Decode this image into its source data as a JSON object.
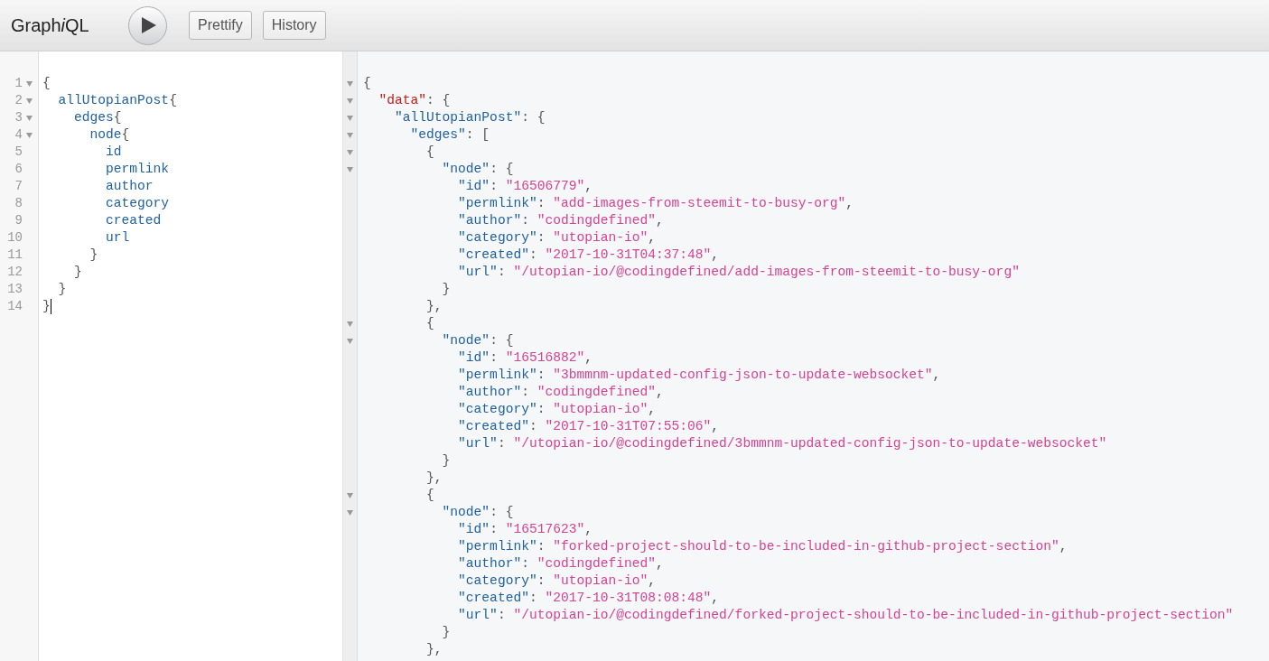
{
  "toolbar": {
    "title": [
      {
        "text": "Graph",
        "italic": false
      },
      {
        "text": "i",
        "italic": true
      },
      {
        "text": "QL",
        "italic": false
      }
    ],
    "buttons": [
      "Prettify",
      "History"
    ]
  },
  "query_editor": {
    "lines": [
      {
        "number": "1",
        "foldable": true,
        "cursor": false,
        "tokens": [
          {
            "kind": "punct",
            "text": "{"
          }
        ]
      },
      {
        "number": "2",
        "foldable": true,
        "cursor": false,
        "tokens": [
          {
            "kind": "field",
            "text": "  allUtopianPost"
          },
          {
            "kind": "punct",
            "text": "{"
          }
        ]
      },
      {
        "number": "3",
        "foldable": true,
        "cursor": false,
        "tokens": [
          {
            "kind": "field",
            "text": "    edges"
          },
          {
            "kind": "punct",
            "text": "{"
          }
        ]
      },
      {
        "number": "4",
        "foldable": true,
        "cursor": false,
        "tokens": [
          {
            "kind": "field",
            "text": "      node"
          },
          {
            "kind": "punct",
            "text": "{"
          }
        ]
      },
      {
        "number": "5",
        "foldable": false,
        "cursor": false,
        "tokens": [
          {
            "kind": "field",
            "text": "        id"
          }
        ]
      },
      {
        "number": "6",
        "foldable": false,
        "cursor": false,
        "tokens": [
          {
            "kind": "field",
            "text": "        permlink"
          }
        ]
      },
      {
        "number": "7",
        "foldable": false,
        "cursor": false,
        "tokens": [
          {
            "kind": "field",
            "text": "        author"
          }
        ]
      },
      {
        "number": "8",
        "foldable": false,
        "cursor": false,
        "tokens": [
          {
            "kind": "field",
            "text": "        category"
          }
        ]
      },
      {
        "number": "9",
        "foldable": false,
        "cursor": false,
        "tokens": [
          {
            "kind": "field",
            "text": "        created"
          }
        ]
      },
      {
        "number": "10",
        "foldable": false,
        "cursor": false,
        "tokens": [
          {
            "kind": "field",
            "text": "        url"
          }
        ]
      },
      {
        "number": "11",
        "foldable": false,
        "cursor": false,
        "tokens": [
          {
            "kind": "punct",
            "text": "      }"
          }
        ]
      },
      {
        "number": "12",
        "foldable": false,
        "cursor": false,
        "tokens": [
          {
            "kind": "punct",
            "text": "    }"
          }
        ]
      },
      {
        "number": "13",
        "foldable": false,
        "cursor": false,
        "tokens": [
          {
            "kind": "punct",
            "text": "  }"
          }
        ]
      },
      {
        "number": "14",
        "foldable": false,
        "cursor": true,
        "tokens": [
          {
            "kind": "punct",
            "text": "}"
          }
        ]
      }
    ]
  },
  "result_viewer": {
    "lines": [
      {
        "foldable": true,
        "tokens": [
          {
            "kind": "punct",
            "text": "{"
          }
        ]
      },
      {
        "foldable": true,
        "tokens": [
          {
            "kind": "root_key",
            "text": "  \"data\""
          },
          {
            "kind": "punct",
            "text": ": {"
          }
        ]
      },
      {
        "foldable": true,
        "tokens": [
          {
            "kind": "key",
            "text": "    \"allUtopianPost\""
          },
          {
            "kind": "punct",
            "text": ": {"
          }
        ]
      },
      {
        "foldable": true,
        "tokens": [
          {
            "kind": "key",
            "text": "      \"edges\""
          },
          {
            "kind": "punct",
            "text": ": ["
          }
        ]
      },
      {
        "foldable": true,
        "tokens": [
          {
            "kind": "punct",
            "text": "        {"
          }
        ]
      },
      {
        "foldable": true,
        "tokens": [
          {
            "kind": "key",
            "text": "          \"node\""
          },
          {
            "kind": "punct",
            "text": ": {"
          }
        ]
      },
      {
        "foldable": false,
        "tokens": [
          {
            "kind": "key",
            "text": "            \"id\""
          },
          {
            "kind": "punct",
            "text": ": "
          },
          {
            "kind": "string",
            "text": "\"16506779\""
          },
          {
            "kind": "punct",
            "text": ","
          }
        ]
      },
      {
        "foldable": false,
        "tokens": [
          {
            "kind": "key",
            "text": "            \"permlink\""
          },
          {
            "kind": "punct",
            "text": ": "
          },
          {
            "kind": "string",
            "text": "\"add-images-from-steemit-to-busy-org\""
          },
          {
            "kind": "punct",
            "text": ","
          }
        ]
      },
      {
        "foldable": false,
        "tokens": [
          {
            "kind": "key",
            "text": "            \"author\""
          },
          {
            "kind": "punct",
            "text": ": "
          },
          {
            "kind": "string",
            "text": "\"codingdefined\""
          },
          {
            "kind": "punct",
            "text": ","
          }
        ]
      },
      {
        "foldable": false,
        "tokens": [
          {
            "kind": "key",
            "text": "            \"category\""
          },
          {
            "kind": "punct",
            "text": ": "
          },
          {
            "kind": "string",
            "text": "\"utopian-io\""
          },
          {
            "kind": "punct",
            "text": ","
          }
        ]
      },
      {
        "foldable": false,
        "tokens": [
          {
            "kind": "key",
            "text": "            \"created\""
          },
          {
            "kind": "punct",
            "text": ": "
          },
          {
            "kind": "string",
            "text": "\"2017-10-31T04:37:48\""
          },
          {
            "kind": "punct",
            "text": ","
          }
        ]
      },
      {
        "foldable": false,
        "tokens": [
          {
            "kind": "key",
            "text": "            \"url\""
          },
          {
            "kind": "punct",
            "text": ": "
          },
          {
            "kind": "string",
            "text": "\"/utopian-io/@codingdefined/add-images-from-steemit-to-busy-org\""
          }
        ]
      },
      {
        "foldable": false,
        "tokens": [
          {
            "kind": "punct",
            "text": "          }"
          }
        ]
      },
      {
        "foldable": false,
        "tokens": [
          {
            "kind": "punct",
            "text": "        },"
          }
        ]
      },
      {
        "foldable": true,
        "tokens": [
          {
            "kind": "punct",
            "text": "        {"
          }
        ]
      },
      {
        "foldable": true,
        "tokens": [
          {
            "kind": "key",
            "text": "          \"node\""
          },
          {
            "kind": "punct",
            "text": ": {"
          }
        ]
      },
      {
        "foldable": false,
        "tokens": [
          {
            "kind": "key",
            "text": "            \"id\""
          },
          {
            "kind": "punct",
            "text": ": "
          },
          {
            "kind": "string",
            "text": "\"16516882\""
          },
          {
            "kind": "punct",
            "text": ","
          }
        ]
      },
      {
        "foldable": false,
        "tokens": [
          {
            "kind": "key",
            "text": "            \"permlink\""
          },
          {
            "kind": "punct",
            "text": ": "
          },
          {
            "kind": "string",
            "text": "\"3bmmnm-updated-config-json-to-update-websocket\""
          },
          {
            "kind": "punct",
            "text": ","
          }
        ]
      },
      {
        "foldable": false,
        "tokens": [
          {
            "kind": "key",
            "text": "            \"author\""
          },
          {
            "kind": "punct",
            "text": ": "
          },
          {
            "kind": "string",
            "text": "\"codingdefined\""
          },
          {
            "kind": "punct",
            "text": ","
          }
        ]
      },
      {
        "foldable": false,
        "tokens": [
          {
            "kind": "key",
            "text": "            \"category\""
          },
          {
            "kind": "punct",
            "text": ": "
          },
          {
            "kind": "string",
            "text": "\"utopian-io\""
          },
          {
            "kind": "punct",
            "text": ","
          }
        ]
      },
      {
        "foldable": false,
        "tokens": [
          {
            "kind": "key",
            "text": "            \"created\""
          },
          {
            "kind": "punct",
            "text": ": "
          },
          {
            "kind": "string",
            "text": "\"2017-10-31T07:55:06\""
          },
          {
            "kind": "punct",
            "text": ","
          }
        ]
      },
      {
        "foldable": false,
        "tokens": [
          {
            "kind": "key",
            "text": "            \"url\""
          },
          {
            "kind": "punct",
            "text": ": "
          },
          {
            "kind": "string",
            "text": "\"/utopian-io/@codingdefined/3bmmnm-updated-config-json-to-update-websocket\""
          }
        ]
      },
      {
        "foldable": false,
        "tokens": [
          {
            "kind": "punct",
            "text": "          }"
          }
        ]
      },
      {
        "foldable": false,
        "tokens": [
          {
            "kind": "punct",
            "text": "        },"
          }
        ]
      },
      {
        "foldable": true,
        "tokens": [
          {
            "kind": "punct",
            "text": "        {"
          }
        ]
      },
      {
        "foldable": true,
        "tokens": [
          {
            "kind": "key",
            "text": "          \"node\""
          },
          {
            "kind": "punct",
            "text": ": {"
          }
        ]
      },
      {
        "foldable": false,
        "tokens": [
          {
            "kind": "key",
            "text": "            \"id\""
          },
          {
            "kind": "punct",
            "text": ": "
          },
          {
            "kind": "string",
            "text": "\"16517623\""
          },
          {
            "kind": "punct",
            "text": ","
          }
        ]
      },
      {
        "foldable": false,
        "tokens": [
          {
            "kind": "key",
            "text": "            \"permlink\""
          },
          {
            "kind": "punct",
            "text": ": "
          },
          {
            "kind": "string",
            "text": "\"forked-project-should-to-be-included-in-github-project-section\""
          },
          {
            "kind": "punct",
            "text": ","
          }
        ]
      },
      {
        "foldable": false,
        "tokens": [
          {
            "kind": "key",
            "text": "            \"author\""
          },
          {
            "kind": "punct",
            "text": ": "
          },
          {
            "kind": "string",
            "text": "\"codingdefined\""
          },
          {
            "kind": "punct",
            "text": ","
          }
        ]
      },
      {
        "foldable": false,
        "tokens": [
          {
            "kind": "key",
            "text": "            \"category\""
          },
          {
            "kind": "punct",
            "text": ": "
          },
          {
            "kind": "string",
            "text": "\"utopian-io\""
          },
          {
            "kind": "punct",
            "text": ","
          }
        ]
      },
      {
        "foldable": false,
        "tokens": [
          {
            "kind": "key",
            "text": "            \"created\""
          },
          {
            "kind": "punct",
            "text": ": "
          },
          {
            "kind": "string",
            "text": "\"2017-10-31T08:08:48\""
          },
          {
            "kind": "punct",
            "text": ","
          }
        ]
      },
      {
        "foldable": false,
        "tokens": [
          {
            "kind": "key",
            "text": "            \"url\""
          },
          {
            "kind": "punct",
            "text": ": "
          },
          {
            "kind": "string",
            "text": "\"/utopian-io/@codingdefined/forked-project-should-to-be-included-in-github-project-section\""
          }
        ]
      },
      {
        "foldable": false,
        "tokens": [
          {
            "kind": "punct",
            "text": "          }"
          }
        ]
      },
      {
        "foldable": false,
        "tokens": [
          {
            "kind": "punct",
            "text": "        },"
          }
        ]
      }
    ]
  }
}
